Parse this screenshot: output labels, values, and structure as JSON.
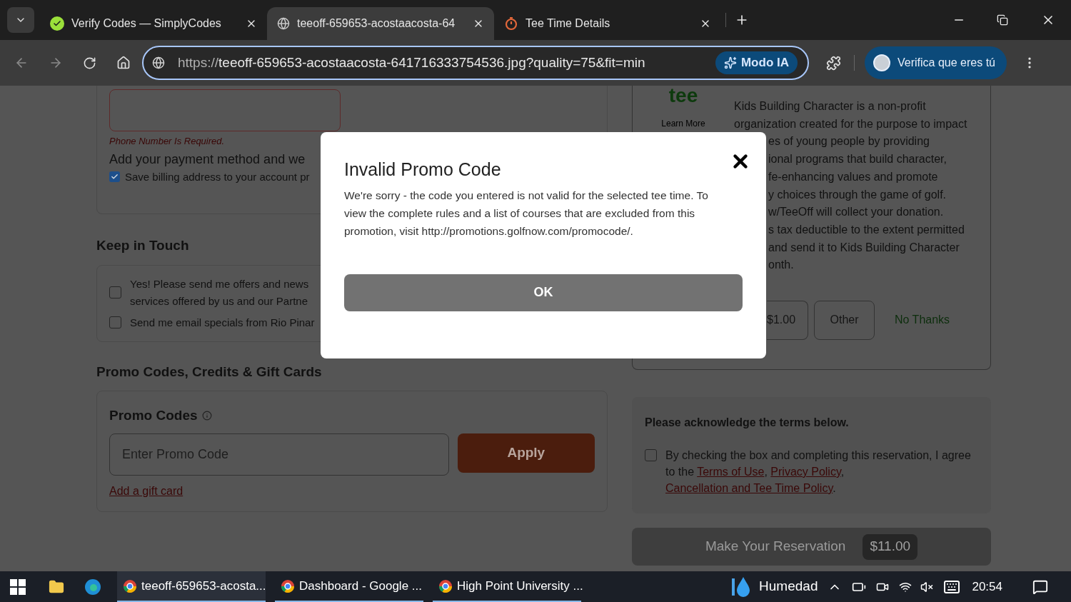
{
  "browser": {
    "tabs": [
      {
        "title": "Verify Codes — SimplyCodes",
        "kind": "check",
        "selected": false
      },
      {
        "title": "teeoff-659653-acostaacosta-64",
        "kind": "globe",
        "selected": true
      },
      {
        "title": "Tee Time Details",
        "kind": "stopwatch",
        "selected": false
      }
    ],
    "address": {
      "scheme": "https://",
      "rest": "teeoff-659653-acostaacosta-641716333754536.jpg?quality=75&fit=min"
    },
    "ai_button": "Modo IA",
    "profile_button": "Verifica que eres tú"
  },
  "left": {
    "phone_error": "Phone Number Is Required.",
    "payment_note": "Add your payment method and we",
    "save_billing": {
      "label": "Save billing address to your account pr",
      "checked": true
    },
    "keep_in_touch": {
      "title": "Keep in Touch",
      "options": [
        {
          "lines": [
            "Yes! Please send me offers and news",
            "services offered by us and our Partne"
          ],
          "checked": false
        },
        {
          "lines": [
            "Send me email specials from Rio Pinar"
          ],
          "checked": false
        }
      ]
    },
    "promo": {
      "section_title": "Promo Codes, Credits & Gift Cards",
      "label": "Promo Codes",
      "placeholder": "Enter Promo Code",
      "apply": "Apply",
      "gift_link": "Add a gift card"
    }
  },
  "right": {
    "charity": {
      "logo_text": "tee",
      "learn_more": "Learn More",
      "lines": [
        "Kids Building Character is a non-profit",
        "organization created for the purpose to impact"
      ],
      "covered_lines": [
        "es of young people by providing",
        "ional programs that build character,",
        "fe-enhancing values and promote",
        "y choices through the game of golf.",
        "w/TeeOff will collect your donation.",
        "s tax deductible to the extent permitted",
        "and send it to Kids Building Character",
        "onth."
      ],
      "amounts": [
        {
          "label": "$1.00",
          "kind": "partial"
        },
        {
          "label": "Other",
          "kind": "button"
        },
        {
          "label": "No Thanks",
          "kind": "link"
        }
      ]
    },
    "terms": {
      "title": "Please acknowledge the terms below.",
      "checked": false,
      "before": "By checking the box and completing this reservation, I agree to the",
      "links": [
        {
          "text": "Terms of Use",
          "after": ","
        },
        {
          "text": "Privacy Policy",
          "after": ","
        },
        {
          "text": "Cancellation and Tee Time Policy",
          "after": "."
        }
      ]
    },
    "reserve": {
      "label": "Make Your Reservation",
      "price": "$11.00"
    }
  },
  "dialog": {
    "title": "Invalid Promo Code",
    "message": "We're sorry - the code you entered is not valid for the selected tee time. To view the complete rules and a list of courses that are excluded from this promotion, visit http://promotions.golfnow.com/promocode/.",
    "ok": "OK"
  },
  "taskbar": {
    "apps": [
      {
        "label": "teeoff-659653-acosta...",
        "selected": true
      },
      {
        "label": "Dashboard - Google ...",
        "selected": false
      },
      {
        "label": "High Point University ...",
        "selected": false
      }
    ],
    "weather": "Humedad",
    "time": "20:54"
  }
}
